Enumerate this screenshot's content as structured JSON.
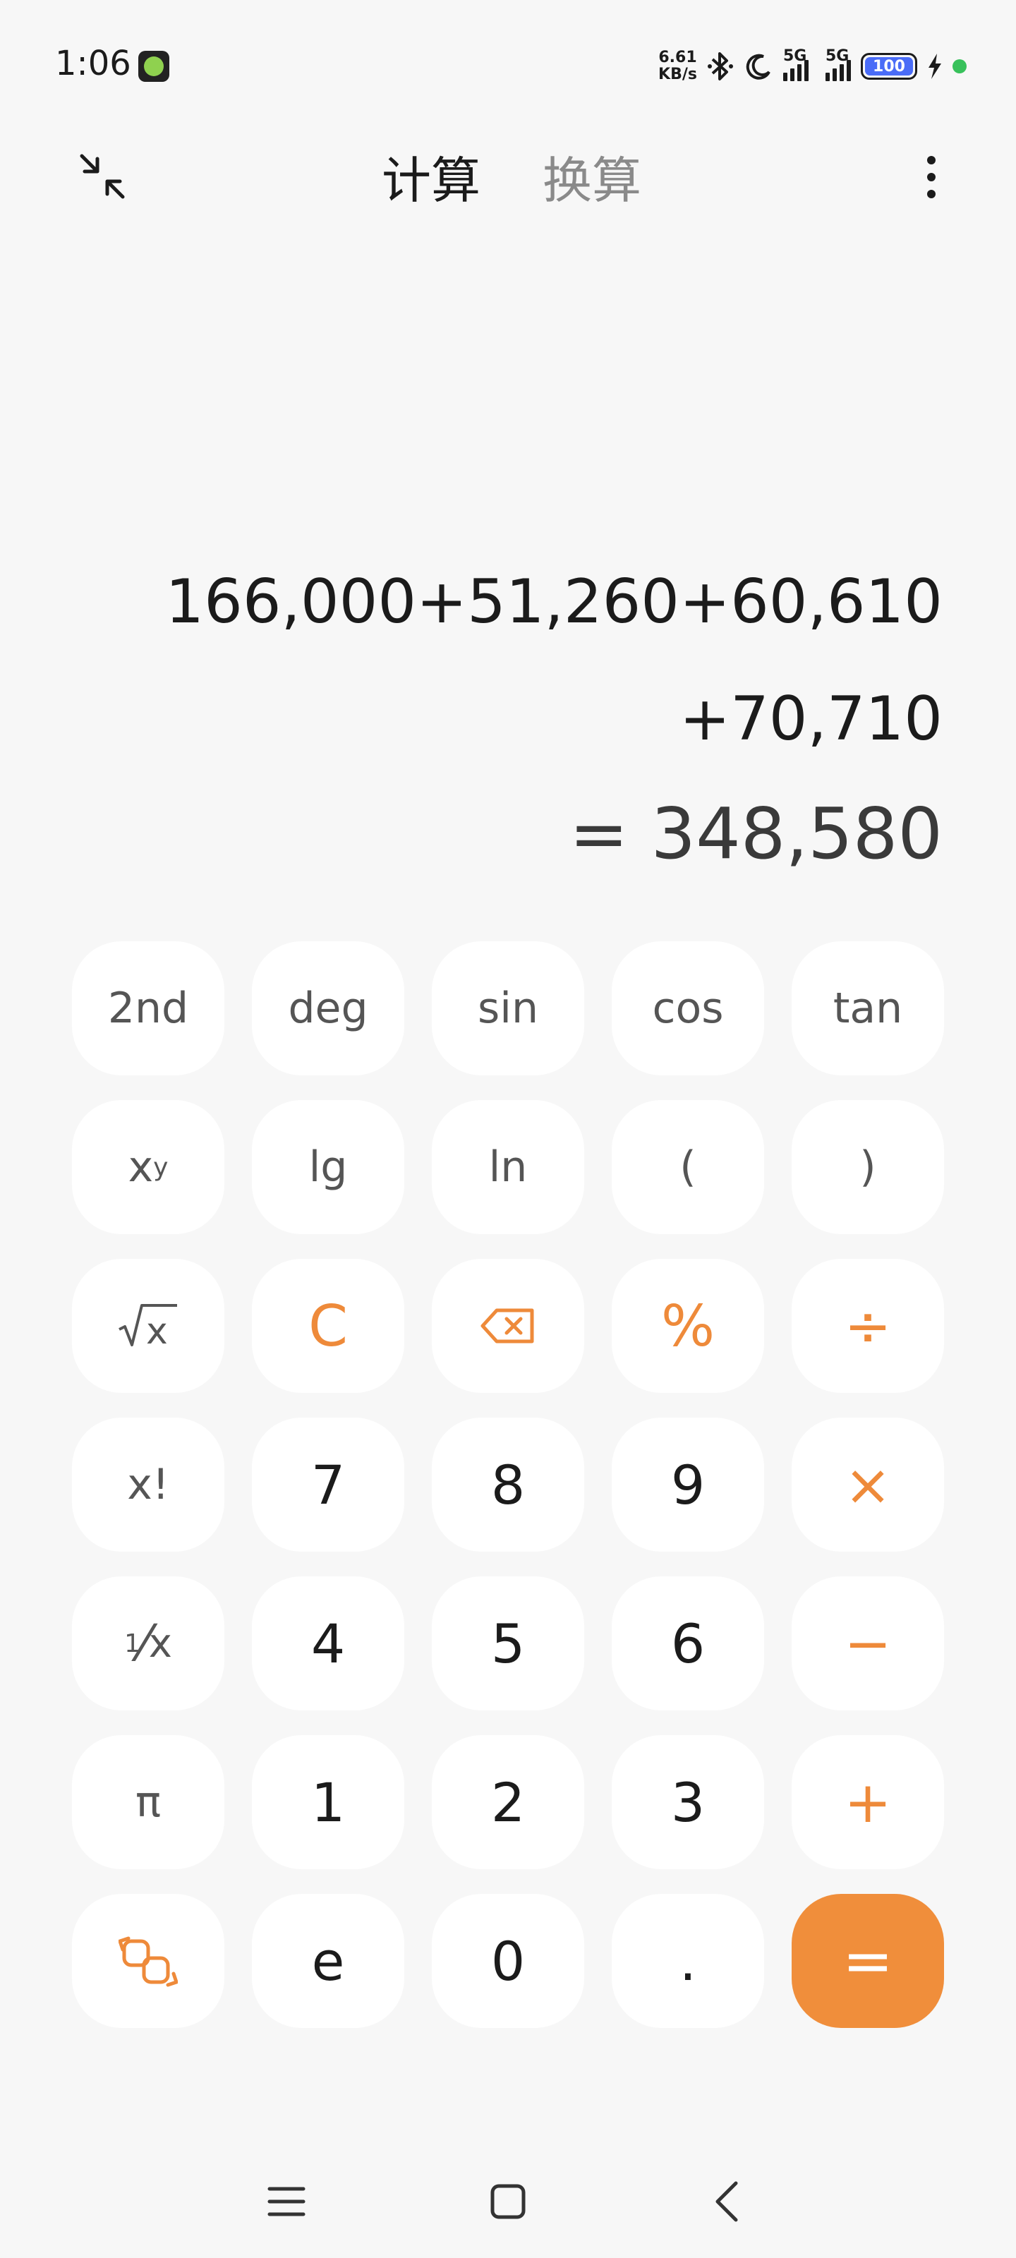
{
  "status_bar": {
    "time": "1:06",
    "net_speed_value": "6.61",
    "net_speed_unit": "KB/s",
    "sim1_tag": "5G",
    "sim2_tag": "5G",
    "battery_level": "100"
  },
  "toolbar": {
    "tabs": [
      {
        "label": "计算",
        "active": true
      },
      {
        "label": "换算",
        "active": false
      }
    ]
  },
  "display": {
    "expression_line1": "166,000+51,260+60,610",
    "expression_line2": "+70,710",
    "result": "= 348,580"
  },
  "keypad": {
    "second": "2nd",
    "deg": "deg",
    "sin": "sin",
    "cos": "cos",
    "tan": "tan",
    "power_base": "x",
    "power_exp": "y",
    "lg": "lg",
    "ln": "ln",
    "lparen": "(",
    "rparen": ")",
    "clear": "C",
    "percent": "%",
    "divide": "÷",
    "factorial": "x!",
    "seven": "7",
    "eight": "8",
    "nine": "9",
    "multiply": "×",
    "recip_num": "1",
    "recip_den": "x",
    "four": "4",
    "five": "5",
    "six": "6",
    "minus": "−",
    "pi": "π",
    "one": "1",
    "two": "2",
    "three": "3",
    "plus": "+",
    "e": "e",
    "zero": "0",
    "dot": ".",
    "equals": "="
  },
  "colors": {
    "accent": "#f08e3b",
    "background": "#f7f7f7",
    "key_background": "#ffffff"
  }
}
